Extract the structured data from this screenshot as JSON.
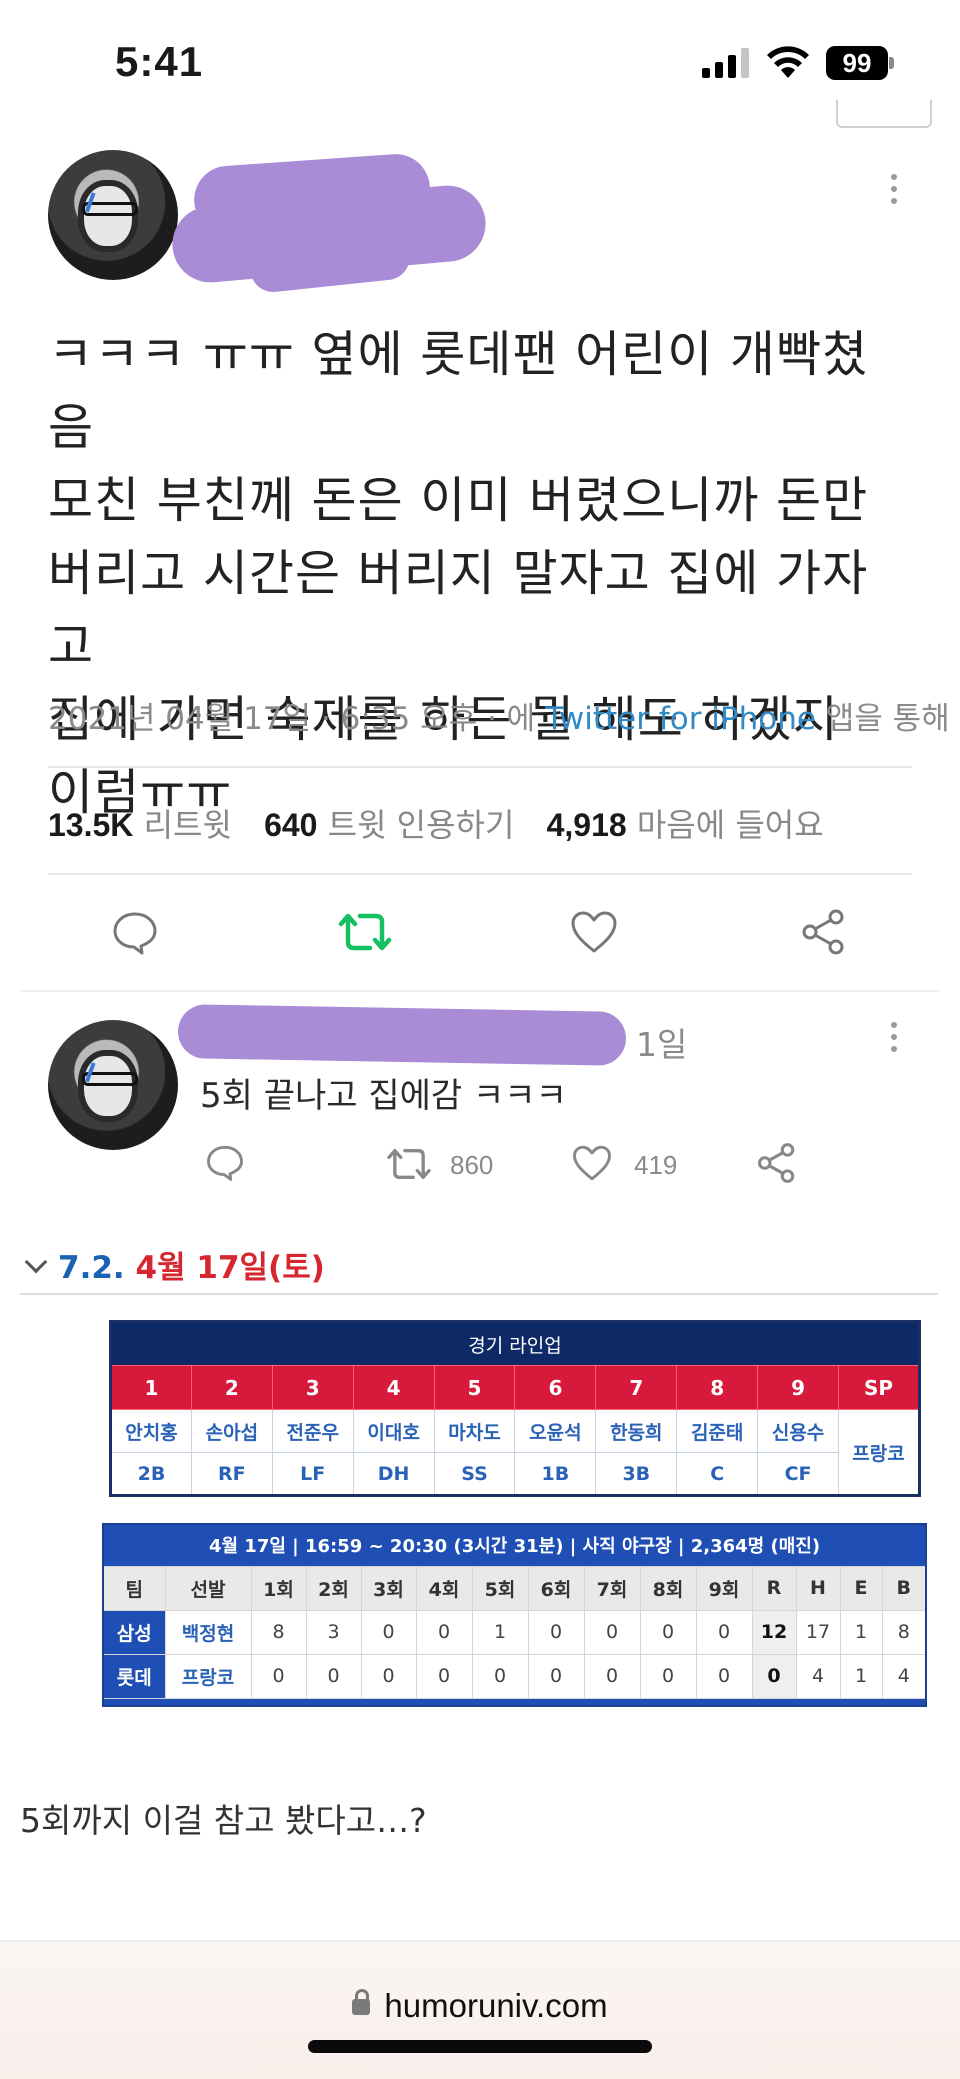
{
  "status_bar": {
    "time": "5:41",
    "battery": "99"
  },
  "tweet": {
    "author_redacted": true,
    "body": "ㅋㅋㅋ ㅠㅠ 옆에 롯데팬 어린이 개빡쳤음\n모친 부친께 돈은 이미 버렸으니까 돈만\n버리고 시간은 버리지 말자고 집에 가자고\n집에 가면 숙제를 하든 뭘 해도 하겠지\n이럼ㅠㅠ",
    "meta_prefix": "2021년 04월 17일 · 6:35 오후 · 에 ",
    "client": "Twitter for iPhone",
    "meta_suffix": " 앱을 통해",
    "stats": {
      "retweets_value": "13.5K",
      "retweets_label": "리트윗",
      "quotes_value": "640",
      "quotes_label": "트윗 인용하기",
      "likes_value": "4,918",
      "likes_label": "마음에 들어요"
    },
    "retweet_color": "#17bf63"
  },
  "reply": {
    "time": "1일",
    "text": "5회 끝나고 집에감 ㅋㅋㅋ",
    "retweet_count": "860",
    "like_count": "419"
  },
  "game": {
    "section_num": "7.2.",
    "section_date": "4월 17일(토)",
    "lineup": {
      "title": "경기 라인업",
      "numbers": [
        "1",
        "2",
        "3",
        "4",
        "5",
        "6",
        "7",
        "8",
        "9",
        "SP"
      ],
      "names": [
        "안치홍",
        "손아섭",
        "전준우",
        "이대호",
        "마차도",
        "오윤석",
        "한동희",
        "김준태",
        "신용수"
      ],
      "positions": [
        "2B",
        "RF",
        "LF",
        "DH",
        "SS",
        "1B",
        "3B",
        "C",
        "CF"
      ],
      "starter": "프랑코"
    },
    "scoreboard": {
      "title": "4월 17일 | 16:59 ~ 20:30 (3시간 31분) | 사직 야구장 | 2,364명 (매진)",
      "headers": [
        "팀",
        "선발",
        "1회",
        "2회",
        "3회",
        "4회",
        "5회",
        "6회",
        "7회",
        "8회",
        "9회",
        "R",
        "H",
        "E",
        "B"
      ],
      "rows": [
        {
          "team": "삼성",
          "pitcher": "백정현",
          "innings": [
            "8",
            "3",
            "0",
            "0",
            "1",
            "0",
            "0",
            "0",
            "0"
          ],
          "r": "12",
          "h": "17",
          "e": "1",
          "b": "8"
        },
        {
          "team": "롯데",
          "pitcher": "프랑코",
          "innings": [
            "0",
            "0",
            "0",
            "0",
            "0",
            "0",
            "0",
            "0",
            "0"
          ],
          "r": "0",
          "h": "4",
          "e": "1",
          "b": "4"
        }
      ]
    }
  },
  "post_caption": "5회까지 이걸 참고 봤다고…?",
  "browser": {
    "url": "humoruniv.com"
  }
}
